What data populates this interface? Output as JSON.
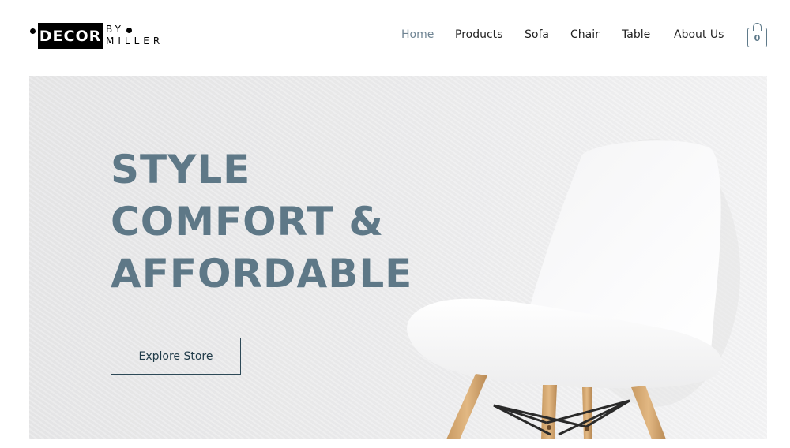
{
  "brand": {
    "box_text": "DECOR",
    "by_text": "BY",
    "sub_text": "MILLER"
  },
  "nav": {
    "items": [
      {
        "label": "Home",
        "active": true
      },
      {
        "label": "Products",
        "active": false
      },
      {
        "label": "Sofa",
        "active": false
      },
      {
        "label": "Chair",
        "active": false
      },
      {
        "label": "Table",
        "active": false
      },
      {
        "label": "About Us",
        "active": false
      }
    ]
  },
  "cart": {
    "count": "0",
    "icon": "shopping-bag-icon"
  },
  "hero": {
    "headline_lines": [
      "STYLE",
      "COMFORT &",
      "AFFORDABLE"
    ],
    "cta_label": "Explore Store",
    "image": "white-chair-image"
  },
  "colors": {
    "accent": "#5e7887",
    "nav_active": "#6f8493",
    "button_border": "#2d4957",
    "hero_bg": "#ebebec"
  }
}
